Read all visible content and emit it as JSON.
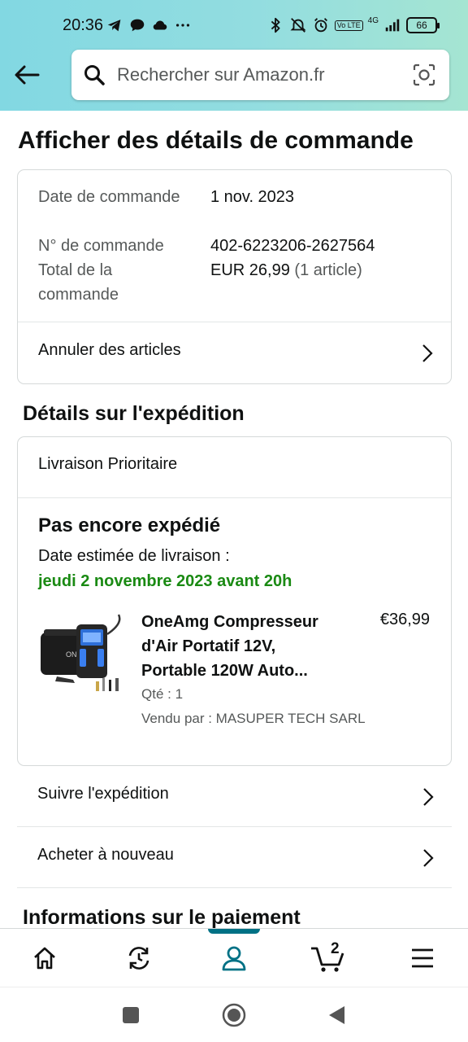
{
  "status_bar": {
    "time": "20:36",
    "network": "4G",
    "volte": "Vo LTE",
    "battery": "66"
  },
  "search": {
    "placeholder": "Rechercher sur Amazon.fr"
  },
  "page": {
    "title": "Afficher des détails de commande"
  },
  "order": {
    "date_label": "Date de commande",
    "date_value": "1 nov. 2023",
    "number_label": "N° de commande",
    "number_value": "402-6223206-2627564",
    "total_label": "Total de la commande",
    "total_value": "EUR 26,99",
    "total_items": "(1 article)",
    "cancel_label": "Annuler des articles"
  },
  "shipment": {
    "section_title": "Détails sur l'expédition",
    "method": "Livraison Prioritaire",
    "status": "Pas encore expédié",
    "est_label": "Date estimée de livraison :",
    "est_date": "jeudi 2 novembre 2023 avant 20h",
    "product": {
      "title_line1": "OneAmg Compresseur",
      "title_line2": "d'Air Portatif 12V,",
      "title_line3": "Portable 120W Auto...",
      "price": "€36,99",
      "qty": "Qté : 1",
      "seller": "Vendu par : MASUPER TECH SARL"
    },
    "track_label": "Suivre l'expédition",
    "buy_again_label": "Acheter à nouveau"
  },
  "payment": {
    "section_title": "Informations sur le paiement"
  },
  "bottom_nav": {
    "cart_count": "2",
    "accent_color": "#007185",
    "items": [
      "home-icon",
      "refresh-icon",
      "account-icon",
      "cart-icon",
      "menu-icon"
    ]
  },
  "colors": {
    "header_gradient_start": "#82d8e2",
    "header_gradient_end": "#a5e5d2",
    "delivery_green": "#1a8a13"
  }
}
